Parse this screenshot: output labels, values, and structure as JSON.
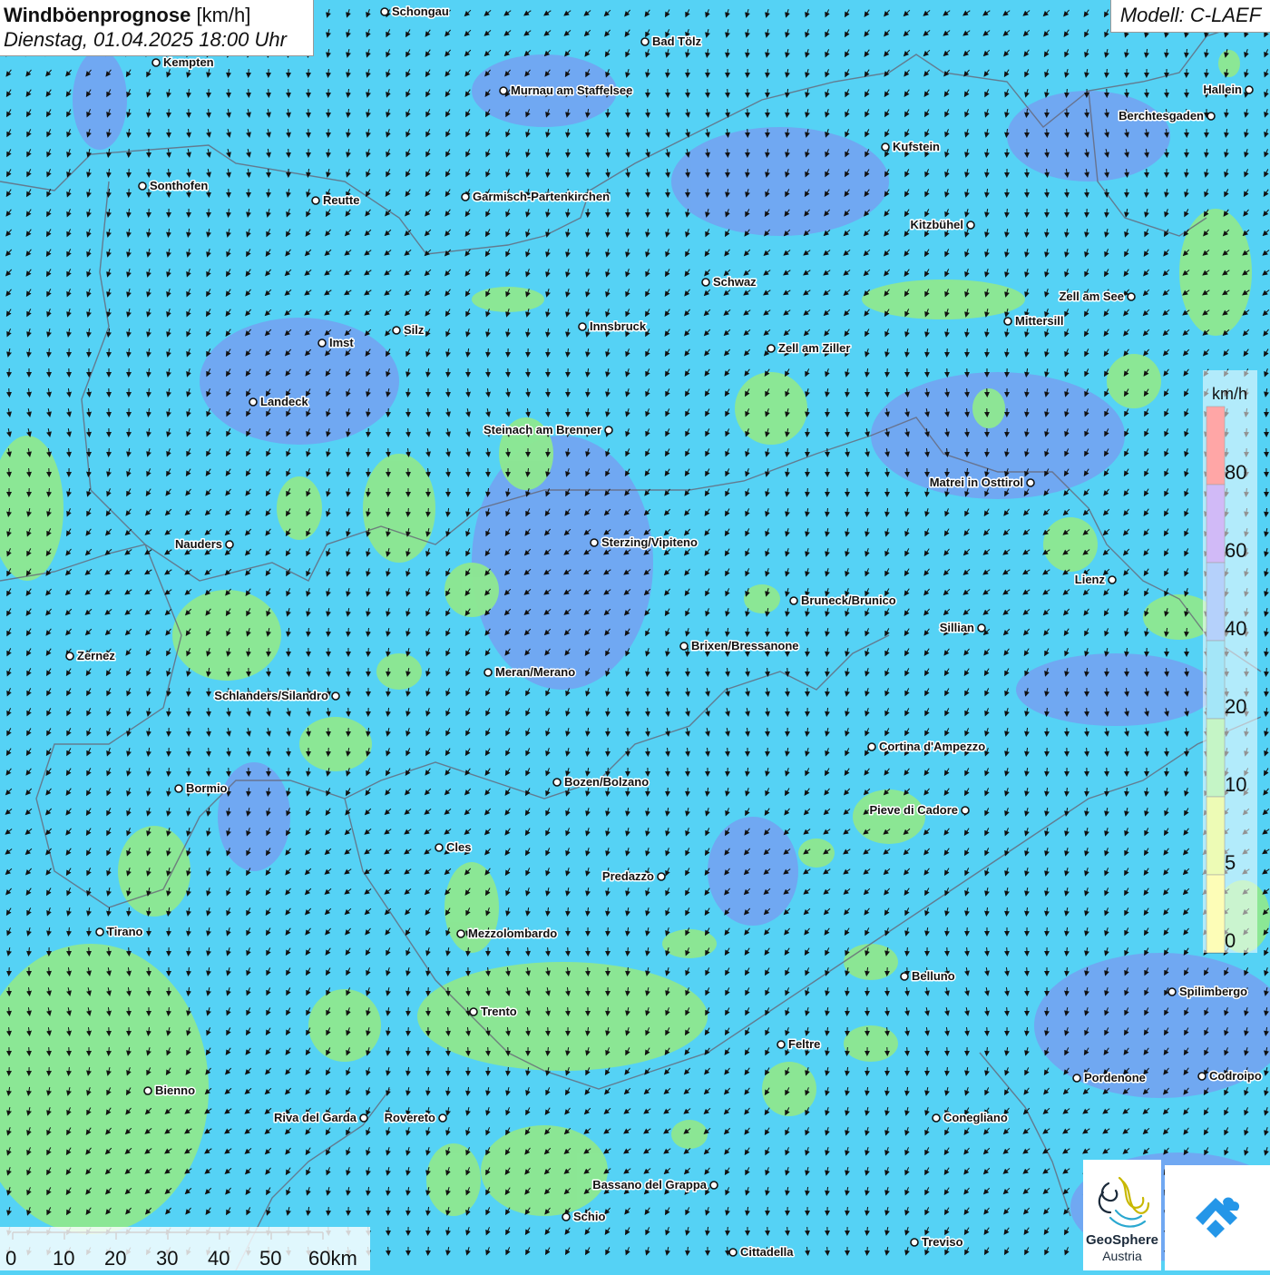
{
  "header": {
    "title_bold": "Windböenprognose",
    "title_unit": "[km/h]",
    "datetime": "Dienstag, 01.04.2025 18:00 Uhr",
    "model": "Modell: C-LAEF"
  },
  "legend": {
    "unit": "km/h",
    "labels": [
      "80",
      "60",
      "40",
      "20",
      "10",
      "5",
      "0"
    ],
    "colors": [
      "#ff3b3b",
      "#9966ee",
      "#5c9af5",
      "#35c8f0",
      "#7fe882",
      "#d8f55c",
      "#fafa60"
    ]
  },
  "scale_bar": {
    "labels": [
      "0",
      "10",
      "20",
      "30",
      "40",
      "50",
      "60km"
    ]
  },
  "logo": {
    "name_line1": "GeoSphere",
    "name_line2": "Austria"
  },
  "cities": [
    {
      "name": "Schongau"
    },
    {
      "name": "Bad Tölz"
    },
    {
      "name": "Kempten"
    },
    {
      "name": "Murnau am Staffelsee"
    },
    {
      "name": "Hallein"
    },
    {
      "name": "Berchtesgaden"
    },
    {
      "name": "Kufstein"
    },
    {
      "name": "Sonthofen"
    },
    {
      "name": "Reutte"
    },
    {
      "name": "Garmisch-Partenkirchen"
    },
    {
      "name": "Kitzbühel"
    },
    {
      "name": "Schwaz"
    },
    {
      "name": "Zell am See"
    },
    {
      "name": "Mittersill"
    },
    {
      "name": "Silz"
    },
    {
      "name": "Innsbruck"
    },
    {
      "name": "Imst"
    },
    {
      "name": "Zell am Ziller"
    },
    {
      "name": "Landeck"
    },
    {
      "name": "Steinach am Brenner"
    },
    {
      "name": "Matrei in Osttirol"
    },
    {
      "name": "Nauders"
    },
    {
      "name": "Sterzing/Vipiteno"
    },
    {
      "name": "Lienz"
    },
    {
      "name": "Bruneck/Brunico"
    },
    {
      "name": "Sillian"
    },
    {
      "name": "Brixen/Bressanone"
    },
    {
      "name": "Zernez"
    },
    {
      "name": "Meran/Merano"
    },
    {
      "name": "Schlanders/Silandro"
    },
    {
      "name": "Cortina d'Ampezzo"
    },
    {
      "name": "Bormio"
    },
    {
      "name": "Bozen/Bolzano"
    },
    {
      "name": "Pieve di Cadore"
    },
    {
      "name": "Cles"
    },
    {
      "name": "Predazzo"
    },
    {
      "name": "Tirano"
    },
    {
      "name": "Mezzolombardo"
    },
    {
      "name": "Belluno"
    },
    {
      "name": "Spilimbergo"
    },
    {
      "name": "Trento"
    },
    {
      "name": "Feltre"
    },
    {
      "name": "Pordenone"
    },
    {
      "name": "Codroipo"
    },
    {
      "name": "Bienno"
    },
    {
      "name": "Riva del Garda"
    },
    {
      "name": "Rovereto"
    },
    {
      "name": "Conegliano"
    },
    {
      "name": "Bassano del Grappa"
    },
    {
      "name": "Schio"
    },
    {
      "name": "Treviso"
    },
    {
      "name": "Cittadella"
    }
  ]
}
